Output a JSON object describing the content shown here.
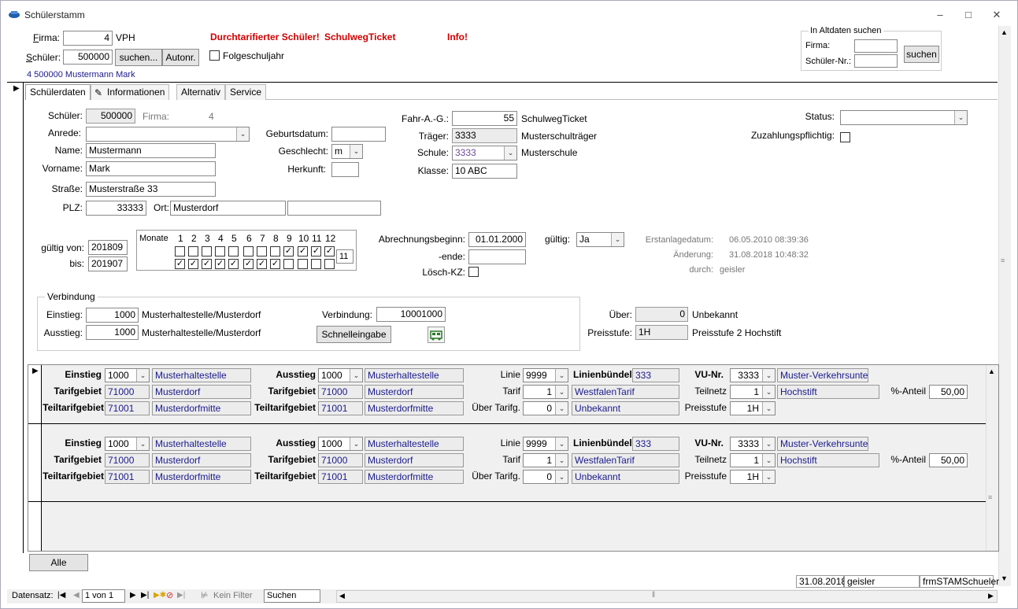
{
  "window": {
    "title": "Schülerstamm"
  },
  "header": {
    "firma_label": "Firma:",
    "firma_value": "4",
    "firma_name": "VPH",
    "schueler_label": "Schüler:",
    "schueler_value": "500000",
    "suchen_button": "suchen...",
    "autonr_button": "Autonr.",
    "folgeschuljahr_label": "Folgeschuljahr",
    "info_line": "4 500000 Mustermann Mark",
    "flag_durchtarifiert": "Durchtarifierter Schüler!",
    "flag_schulweg": "SchulwegTicket",
    "flag_info": "Info!"
  },
  "altdaten": {
    "title": "In Altdaten suchen",
    "firma_label": "Firma:",
    "schueler_label": "Schüler-Nr.:",
    "button": "suchen"
  },
  "tabs": [
    "Schülerdaten",
    "Informationen",
    "Alternativ",
    "Service"
  ],
  "student": {
    "schueler_label": "Schüler:",
    "schueler_value": "500000",
    "firma_label": "Firma:",
    "firma_value": "4",
    "anrede_label": "Anrede:",
    "anrede_value": "",
    "name_label": "Name:",
    "name_value": "Mustermann",
    "vorname_label": "Vorname:",
    "vorname_value": "Mark",
    "strasse_label": "Straße:",
    "strasse_value": "Musterstraße 33",
    "plz_label": "PLZ:",
    "plz_value": "33333",
    "ort_label": "Ort:",
    "ort_value": "Musterdorf",
    "ort_extra": "",
    "geburtsdatum_label": "Geburtsdatum:",
    "geburtsdatum_value": "",
    "geschlecht_label": "Geschlecht:",
    "geschlecht_value": "m",
    "herkunft_label": "Herkunft:",
    "herkunft_value": ""
  },
  "school": {
    "fahr_label": "Fahr-A.-G.:",
    "fahr_value": "55",
    "fahr_name": "SchulwegTicket",
    "traeger_label": "Träger:",
    "traeger_value": "3333",
    "traeger_name": "Musterschulträger",
    "schule_label": "Schule:",
    "schule_value": "3333",
    "schule_name": "Musterschule",
    "klasse_label": "Klasse:",
    "klasse_value": "10 ABC"
  },
  "status": {
    "status_label": "Status:",
    "status_value": "",
    "zuzahlung_label": "Zuzahlungspflichtig:"
  },
  "validity": {
    "von_label": "gültig von:",
    "von_value": "201809",
    "bis_label": "bis:",
    "bis_value": "201907",
    "monate_label": "Monate",
    "months": [
      "1",
      "2",
      "3",
      "4",
      "5",
      "6",
      "7",
      "8",
      "9",
      "10",
      "11",
      "12"
    ],
    "row1_checked": [
      false,
      false,
      false,
      false,
      false,
      false,
      false,
      false,
      true,
      true,
      true,
      true
    ],
    "row2_checked": [
      true,
      true,
      true,
      true,
      true,
      true,
      true,
      true,
      false,
      false,
      false,
      false
    ],
    "count": "11"
  },
  "billing": {
    "beginn_label": "Abrechnungsbeginn:",
    "beginn_value": "01.01.2000",
    "ende_label": "-ende:",
    "ende_value": "",
    "loesch_label": "Lösch-KZ:",
    "gueltig_label": "gültig:",
    "gueltig_value": "Ja",
    "erstanlage_label": "Erstanlagedatum:",
    "erstanlage_value": "06.05.2010 08:39:36",
    "aenderung_label": "Änderung:",
    "aenderung_value": "31.08.2018 10:48:32",
    "durch_label": "durch:",
    "durch_value": "geisler"
  },
  "verbindung": {
    "group_title": "Verbindung",
    "einstieg_label": "Einstieg:",
    "einstieg_value": "1000",
    "einstieg_name": "Musterhaltestelle/Musterdorf",
    "ausstieg_label": "Ausstieg:",
    "ausstieg_value": "1000",
    "ausstieg_name": "Musterhaltestelle/Musterdorf",
    "verbindung_label": "Verbindung:",
    "verbindung_value": "10001000",
    "schnell_button": "Schnelleingabe",
    "ueber_label": "Über:",
    "ueber_value": "0",
    "ueber_name": "Unbekannt",
    "preisstufe_label": "Preisstufe:",
    "preisstufe_value": "1H",
    "preisstufe_name": "Preisstufe 2 Hochstift"
  },
  "routes_labels": {
    "einstieg": "Einstieg",
    "ausstieg": "Ausstieg",
    "tarifgebiet": "Tarifgebiet",
    "teiltarifgebiet": "Teiltarifgebiet",
    "linie": "Linie",
    "linienbuendel": "Linienbündel",
    "tarif": "Tarif",
    "ueber_tarifg": "Über Tarifg.",
    "vu_nr": "VU-Nr.",
    "teilnetz": "Teilnetz",
    "preisstufe": "Preisstufe",
    "anteil": "%-Anteil"
  },
  "routes": [
    {
      "einstieg": "1000",
      "einstieg_name": "Musterhaltestelle",
      "tarifgebiet": "71000",
      "tarifgebiet_name": "Musterdorf",
      "teiltarifgebiet": "71001",
      "teiltarifgebiet_name": "Musterdorfmitte",
      "ausstieg": "1000",
      "ausstieg_name": "Musterhaltestelle",
      "a_tarifgebiet": "71000",
      "a_tarifgebiet_name": "Musterdorf",
      "a_teiltarifgebiet": "71001",
      "a_teiltarifgebiet_name": "Musterdorfmitte",
      "linie": "9999",
      "linienbuendel": "333",
      "tarif": "1",
      "tarif_name": "WestfalenTarif",
      "ueber_tarifg": "0",
      "ueber_tarifg_name": "Unbekannt",
      "vu_nr": "3333",
      "vu_name": "Muster-Verkehrsunte",
      "teilnetz": "1",
      "teilnetz_name": "Hochstift",
      "preisstufe": "1H",
      "anteil": "50,00"
    },
    {
      "einstieg": "1000",
      "einstieg_name": "Musterhaltestelle",
      "tarifgebiet": "71000",
      "tarifgebiet_name": "Musterdorf",
      "teiltarifgebiet": "71001",
      "teiltarifgebiet_name": "Musterdorfmitte",
      "ausstieg": "1000",
      "ausstieg_name": "Musterhaltestelle",
      "a_tarifgebiet": "71000",
      "a_tarifgebiet_name": "Musterdorf",
      "a_teiltarifgebiet": "71001",
      "a_teiltarifgebiet_name": "Musterdorfmitte",
      "linie": "9999",
      "linienbuendel": "333",
      "tarif": "1",
      "tarif_name": "WestfalenTarif",
      "ueber_tarifg": "0",
      "ueber_tarifg_name": "Unbekannt",
      "vu_nr": "3333",
      "vu_name": "Muster-Verkehrsunte",
      "teilnetz": "1",
      "teilnetz_name": "Hochstift",
      "preisstufe": "1H",
      "anteil": "50,00"
    }
  ],
  "footer": {
    "alle_button": "Alle",
    "date": "31.08.2018",
    "user": "geisler",
    "form": "frmSTAMSchueler"
  },
  "navbar": {
    "datensatz_label": "Datensatz:",
    "record": "1 von 1",
    "filter": "Kein Filter",
    "search": "Suchen"
  }
}
